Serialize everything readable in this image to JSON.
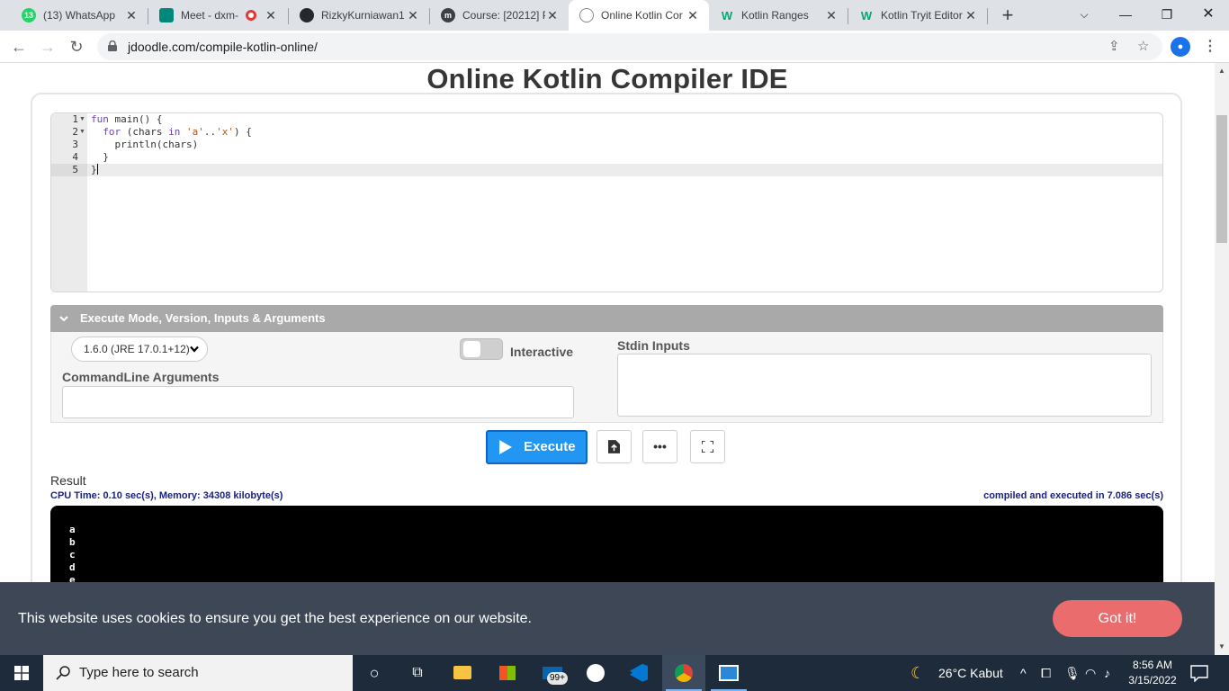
{
  "browser": {
    "tabs": [
      {
        "title": "(13) WhatsApp",
        "badge": "13",
        "icon": "whatsapp-icon"
      },
      {
        "title": "Meet - dxm-",
        "icon": "google-meet-icon",
        "recording": true
      },
      {
        "title": "RizkyKurniawan1",
        "icon": "github-icon"
      },
      {
        "title": "Course: [20212] P",
        "icon": "moodle-icon",
        "icon_letter": "m"
      },
      {
        "title": "Online Kotlin Cor",
        "icon": "jdoodle-icon",
        "active": true
      },
      {
        "title": "Kotlin Ranges",
        "icon": "w3schools-icon",
        "icon_letter": "W"
      },
      {
        "title": "Kotlin Tryit Editor",
        "icon": "w3schools-icon",
        "icon_letter": "W"
      }
    ],
    "url": "jdoodle.com/compile-kotlin-online/"
  },
  "page": {
    "title": "Online Kotlin Compiler IDE",
    "editor": {
      "line_numbers": [
        "1",
        "2",
        "3",
        "4",
        "5"
      ],
      "lines": [
        "fun main() {",
        "  for (chars in 'a'..'x') {",
        "    println(chars)",
        "  }",
        "}"
      ]
    },
    "exec_panel": {
      "header": "Execute Mode, Version, Inputs & Arguments",
      "version": "1.6.0 (JRE 17.0.1+12)",
      "interactive_label": "Interactive",
      "interactive_on": false,
      "cmd_args_label": "CommandLine Arguments",
      "cmd_args_value": "",
      "stdin_label": "Stdin Inputs",
      "stdin_value": ""
    },
    "buttons": {
      "execute": "Execute",
      "more": "•••"
    },
    "result": {
      "label": "Result",
      "cpu_time": "CPU Time: 0.10 sec(s), Memory: 34308 kilobyte(s)",
      "exec_time": "compiled and executed in 7.086 sec(s)",
      "output": [
        "a",
        "b",
        "c",
        "d",
        "e"
      ]
    },
    "cookie": {
      "message": "This website uses cookies to ensure you get the best experience on our website.",
      "button": "Got it!"
    }
  },
  "taskbar": {
    "search_placeholder": "Type here to search",
    "mail_badge": "99+",
    "weather": "26°C  Kabut",
    "time": "8:56 AM",
    "date": "3/15/2022"
  },
  "colors": {
    "execute_button": "#2196f3",
    "exec_header": "#a9a9a9",
    "cookie_bar": "#3d4756",
    "cookie_button": "#ea6c6c",
    "stats_text": "#1a237e",
    "taskbar": "#1e2b3a"
  }
}
